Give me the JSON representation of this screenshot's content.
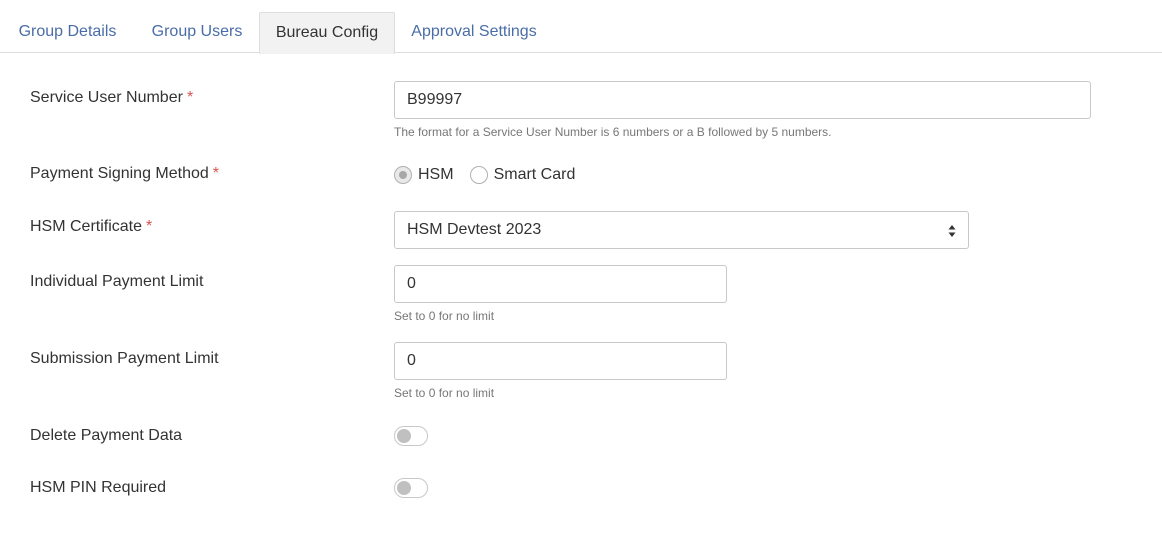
{
  "tabs": [
    {
      "label": "Group Details"
    },
    {
      "label": "Group Users"
    },
    {
      "label": "Bureau Config"
    },
    {
      "label": "Approval Settings"
    }
  ],
  "active_tab": "Bureau Config",
  "form": {
    "service_user_number": {
      "label": "Service User Number",
      "required_mark": "*",
      "value": "B99997",
      "help": "The format for a Service User Number is 6 numbers or a B followed by 5 numbers."
    },
    "payment_signing_method": {
      "label": "Payment Signing Method",
      "required_mark": "*",
      "options": [
        "HSM",
        "Smart Card"
      ],
      "selected": "HSM"
    },
    "hsm_certificate": {
      "label": "HSM Certificate",
      "required_mark": "*",
      "selected": "HSM Devtest 2023"
    },
    "individual_payment_limit": {
      "label": "Individual Payment Limit",
      "value": "0",
      "help": "Set to 0 for no limit"
    },
    "submission_payment_limit": {
      "label": "Submission Payment Limit",
      "value": "0",
      "help": "Set to 0 for no limit"
    },
    "delete_payment_data": {
      "label": "Delete Payment Data",
      "enabled": false
    },
    "hsm_pin_required": {
      "label": "HSM PIN Required",
      "enabled": false
    }
  },
  "colors": {
    "link": "#4a6da7",
    "required": "#d9534f",
    "border": "#c8c8c8"
  }
}
